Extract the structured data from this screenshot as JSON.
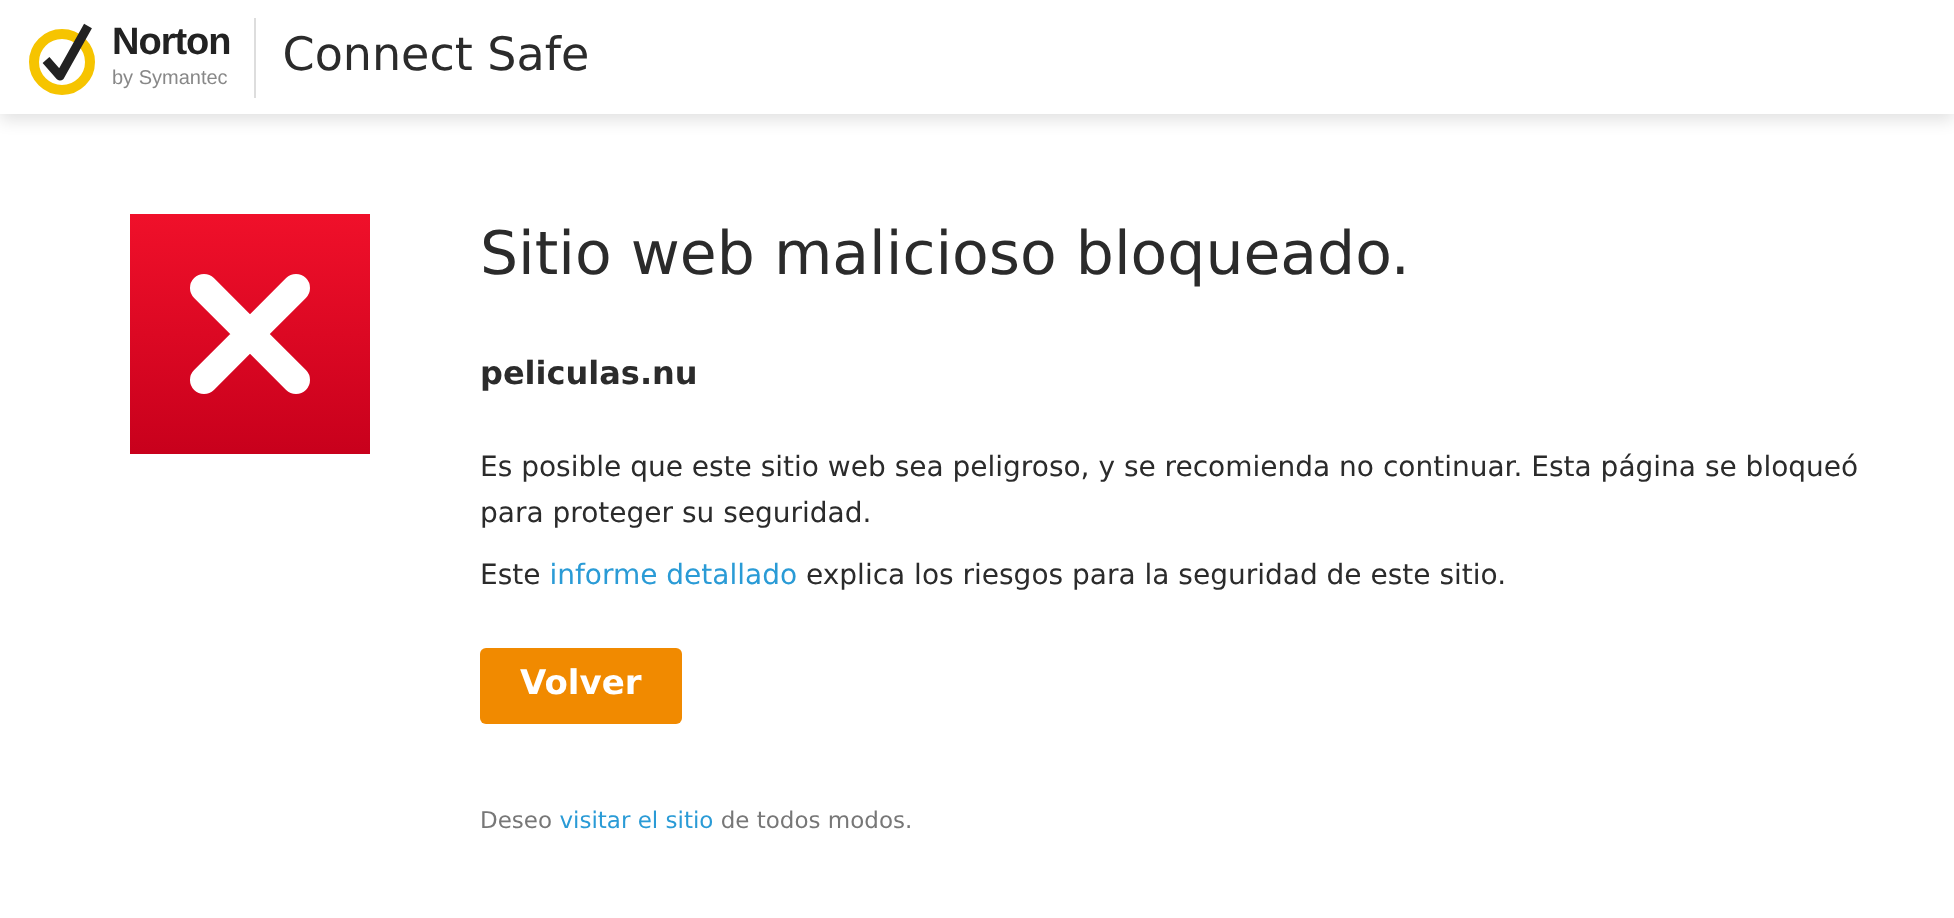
{
  "header": {
    "brand": "Norton",
    "brand_sub": "by Symantec",
    "product": "Connect Safe"
  },
  "page": {
    "title": "Sitio web malicioso bloqueado.",
    "domain": "peliculas.nu",
    "warning": "Es posible que este sitio web sea peligroso, y se recomienda no continuar. Esta página se bloqueó para proteger su seguridad.",
    "report": {
      "before": "Este ",
      "link": "informe detallado",
      "after": " explica los riesgos para la seguridad de este sitio."
    },
    "button": "Volver",
    "proceed": {
      "before": "Deseo ",
      "link": "visitar el sitio",
      "after": " de todos modos."
    }
  }
}
